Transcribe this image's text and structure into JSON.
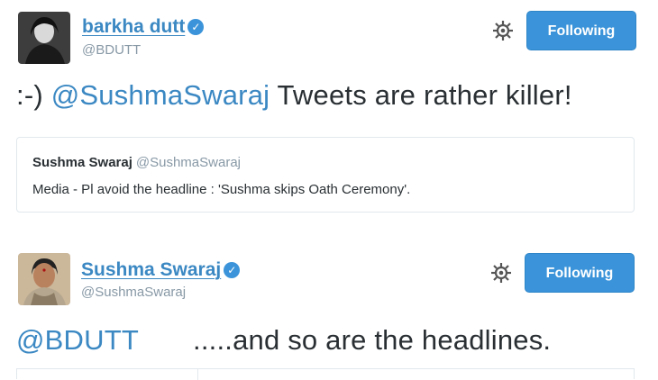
{
  "tweet1": {
    "author_name": "barkha dutt",
    "author_handle": "@BDUTT",
    "follow_label": "Following",
    "text_prefix": ":-) ",
    "mention": "@SushmaSwaraj",
    "text_suffix": " Tweets are rather killer!",
    "quoted": {
      "author_name": "Sushma Swaraj",
      "author_handle": "@SushmaSwaraj",
      "text": "Media - Pl avoid the headline : 'Sushma skips Oath Ceremony'."
    }
  },
  "tweet2": {
    "author_name": "Sushma Swaraj",
    "author_handle": "@SushmaSwaraj",
    "follow_label": "Following",
    "mention": "@BDUTT",
    "text_suffix": ".....and so are the headlines."
  },
  "icons": {
    "verified": "verified-badge-icon",
    "gear": "gear-icon"
  },
  "colors": {
    "link": "#3b88c3",
    "follow_button": "#3b94d9",
    "handle": "#8899a6",
    "text": "#292f33",
    "border": "#e1e8ed"
  }
}
